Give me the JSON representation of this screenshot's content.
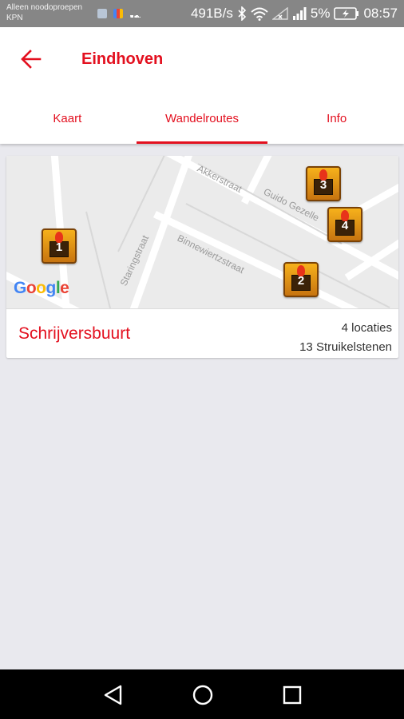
{
  "status_bar": {
    "carrier_line1": "Alleen noodoproepen",
    "carrier_line2": "KPN",
    "speed": "491B/s",
    "battery": "5%",
    "time": "08:57"
  },
  "header": {
    "title": "Eindhoven"
  },
  "tabs": [
    {
      "label": "Kaart",
      "active": false
    },
    {
      "label": "Wandelroutes",
      "active": true
    },
    {
      "label": "Info",
      "active": false
    }
  ],
  "route": {
    "name": "Schrijversbuurt",
    "locations": "4 locaties",
    "stones": "13 Struikelstenen",
    "map": {
      "streets": [
        "Akkerstraat",
        "Guido Gezelle",
        "Binnewiertzstraat",
        "Staringstraat"
      ],
      "markers": [
        "1",
        "2",
        "3",
        "4"
      ],
      "attribution": "Google"
    }
  },
  "colors": {
    "accent": "#e3101f",
    "status_bar": "#868686",
    "background": "#e9e9ee"
  },
  "icons": [
    "back-arrow-icon",
    "bluetooth-icon",
    "wifi-icon",
    "signal-icon",
    "battery-icon",
    "nav-back-icon",
    "nav-home-icon",
    "nav-recents-icon"
  ]
}
